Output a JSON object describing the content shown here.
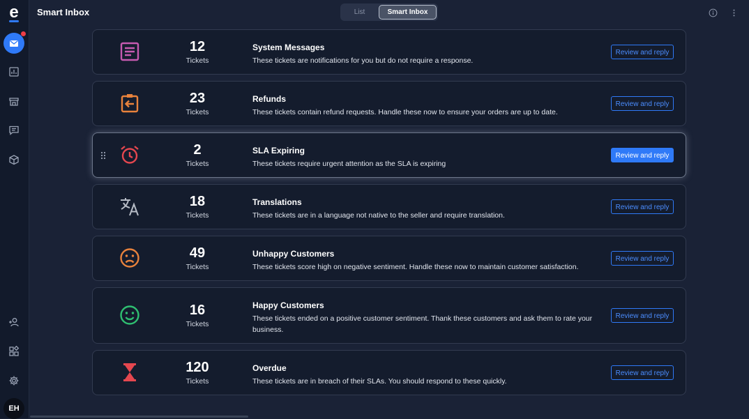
{
  "header": {
    "title": "Smart Inbox",
    "view_toggle": {
      "options": [
        "List",
        "Smart Inbox"
      ],
      "selected": "Smart Inbox"
    }
  },
  "user": {
    "initials": "EH"
  },
  "colors": {
    "accent": "#2f7af8",
    "background": "#1a2236",
    "notification": "#ef3e46"
  },
  "sidebar": {
    "items": [
      {
        "icon": "mail-icon",
        "active": true,
        "has_notification": true
      },
      {
        "icon": "chart-icon"
      },
      {
        "icon": "store-icon"
      },
      {
        "icon": "chat-icon"
      },
      {
        "icon": "package-icon"
      },
      {
        "icon": "add-user-icon"
      },
      {
        "icon": "apps-icon"
      },
      {
        "icon": "gear-icon"
      }
    ]
  },
  "cards": [
    {
      "icon": "message-box-icon",
      "icon_color": "#c65ab0",
      "count": "12",
      "count_label": "Tickets",
      "title": "System Messages",
      "description": "These tickets are notifications for you but do not require a response.",
      "button": "Review and reply"
    },
    {
      "icon": "clipboard-arrow-icon",
      "icon_color": "#e8823c",
      "count": "23",
      "count_label": "Tickets",
      "title": "Refunds",
      "description": "These tickets contain refund requests. Handle these now to ensure your orders are up to date.",
      "button": "Review and reply"
    },
    {
      "icon": "alarm-clock-icon",
      "icon_color": "#e5474f",
      "count": "2",
      "count_label": "Tickets",
      "title": "SLA Expiring",
      "description": "These tickets require urgent attention as the SLA is expiring",
      "button": "Review and reply",
      "highlighted": true
    },
    {
      "icon": "translate-icon",
      "icon_color": "#b7bcc6",
      "count": "18",
      "count_label": "Tickets",
      "title": "Translations",
      "description": "These tickets are in a language not native to the seller and require translation.",
      "button": "Review and reply"
    },
    {
      "icon": "sad-face-icon",
      "icon_color": "#e8823c",
      "count": "49",
      "count_label": "Tickets",
      "title": "Unhappy Customers",
      "description": "These tickets score high on negative sentiment. Handle these now to maintain customer satisfaction.",
      "button": "Review and reply"
    },
    {
      "icon": "happy-face-icon",
      "icon_color": "#2fbf71",
      "count": "16",
      "count_label": "Tickets",
      "title": "Happy Customers",
      "description": "These tickets ended on a positive customer sentiment. Thank these customers and ask them to rate your business.",
      "button": "Review and reply"
    },
    {
      "icon": "hourglass-icon",
      "icon_color": "#e5474f",
      "count": "120",
      "count_label": "Tickets",
      "title": "Overdue",
      "description": "These tickets are in breach of their SLAs. You should respond to these quickly.",
      "button": "Review and reply"
    }
  ]
}
